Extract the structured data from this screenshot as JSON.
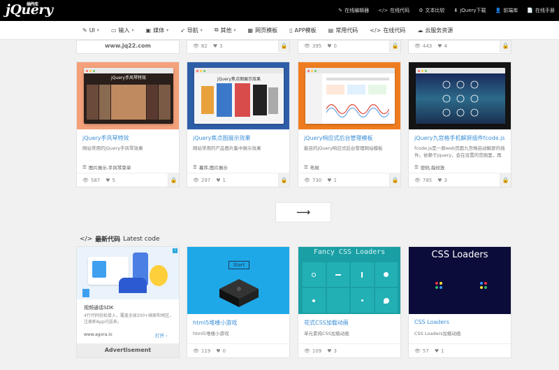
{
  "brand": {
    "logo": "jQuery",
    "logo_small": "插件库"
  },
  "toplinks": [
    {
      "icon": "✎",
      "label": "在线编辑器"
    },
    {
      "icon": "</>",
      "label": "在线代码"
    },
    {
      "icon": "⚙",
      "label": "文本比较"
    },
    {
      "icon": "⬇",
      "label": "jQuery下载"
    },
    {
      "icon": "👤",
      "label": "前端库"
    },
    {
      "icon": "📄",
      "label": "在线手册"
    }
  ],
  "nav": [
    {
      "icon": "✎",
      "label": "UI",
      "chevron": true
    },
    {
      "icon": "▭",
      "label": "输入",
      "chevron": true
    },
    {
      "icon": "▣",
      "label": "媒体",
      "chevron": true
    },
    {
      "icon": "➶",
      "label": "导航",
      "chevron": true
    },
    {
      "icon": "⧉",
      "label": "其他",
      "chevron": true
    },
    {
      "icon": "▦",
      "label": "网页模板",
      "chevron": false
    },
    {
      "icon": "▯",
      "label": "APP模板",
      "chevron": false
    },
    {
      "icon": "▤",
      "label": "常用代码",
      "chevron": false
    },
    {
      "icon": "</>",
      "label": "在线代码",
      "chevron": false
    },
    {
      "icon": "☁",
      "label": "云服务资源",
      "chevron": false
    }
  ],
  "partial_row": [
    {
      "site": "www.jq22.com"
    },
    {
      "views": "82",
      "likes": "3"
    },
    {
      "views": "395",
      "likes": "0"
    },
    {
      "views": "443",
      "likes": "4"
    }
  ],
  "cards": [
    {
      "title": "jQuery手风琴特效",
      "desc": "网站常用的jQuery手风琴效果",
      "tags": "图片展示,手风琴菜单",
      "views": "587",
      "likes": "5",
      "thumb_text": "jQuery手风琴特效"
    },
    {
      "title": "jQuery焦点图展示效果",
      "desc": "网站常用的产品图片集中展示效果",
      "tags": "幕序,图片展示",
      "views": "297",
      "likes": "1",
      "thumb_text": "jQuery焦点图展示效果"
    },
    {
      "title": "jQuery响应式后台管理模板",
      "desc": "能自的jQuery响应式后台管理网站模板",
      "tags": "布局",
      "views": "730",
      "likes": "1",
      "thumb_text": ""
    },
    {
      "title": "jQuery九宫格手机解屏插件fcode.js",
      "desc": "fcode.js是一款web页面九宫格启动解屏的插件。依赖于jquery，会在设置的范围里，再",
      "tags": "密码,指纹放",
      "views": "785",
      "likes": "3",
      "thumb_text": ""
    }
  ],
  "more_button": "⟶",
  "section": {
    "icon": "</>",
    "title": "最新代码",
    "subtitle": "Latest code"
  },
  "ad": {
    "title": "视频通话SDK",
    "desc": "4行代码轻松接入，覆盖全球200+国家和地区，注册即App闪送来。",
    "url": "www.agora.io",
    "open": "打开 ›",
    "badge": "i",
    "footer": "Advertisement"
  },
  "latest": [
    {
      "title": "html5堆楼小游戏",
      "desc": "html5堆楼小游戏",
      "views": "119",
      "likes": "0",
      "thumb_text": "Start"
    },
    {
      "title": "花式CSS加载动画",
      "desc": "单元素纯CSS加载动画",
      "views": "109",
      "likes": "3",
      "thumb_text": "Fancy CSS Loaders"
    },
    {
      "title": "CSS Loaders",
      "desc": "CSS Loaders加载动画",
      "views": "57",
      "likes": "1",
      "thumb_text": "CSS Loaders"
    }
  ]
}
